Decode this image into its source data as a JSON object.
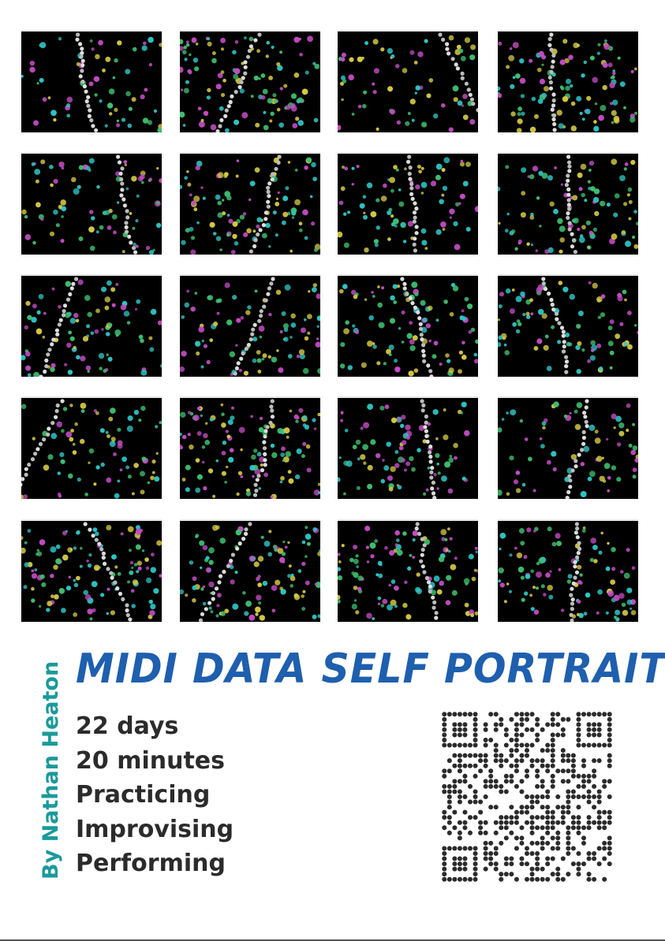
{
  "poster": {
    "title": "MIDI DATA SELF PORTRAIT",
    "author": "By Nathan Heaton",
    "stats": [
      "22 days",
      "20 minutes",
      "Practicing",
      "Improvising",
      "Performing"
    ]
  },
  "colors": {
    "title": "#1e5fae",
    "author": "#1a9a9a",
    "text": "#2b2b2b",
    "dot_palette": [
      "#2ec4c4",
      "#d4c843",
      "#c44cc4",
      "#3fbf6f",
      "#bcbcbc"
    ]
  },
  "thumbnails": [
    {
      "id": "day-01"
    },
    {
      "id": "day-02"
    },
    {
      "id": "day-03"
    },
    {
      "id": "day-04"
    },
    {
      "id": "day-05"
    },
    {
      "id": "day-06"
    },
    {
      "id": "day-07"
    },
    {
      "id": "day-08"
    },
    {
      "id": "day-09"
    },
    {
      "id": "day-10"
    },
    {
      "id": "day-11"
    },
    {
      "id": "day-12"
    },
    {
      "id": "day-13"
    },
    {
      "id": "day-14"
    },
    {
      "id": "day-15"
    },
    {
      "id": "day-16"
    },
    {
      "id": "day-17"
    },
    {
      "id": "day-18"
    },
    {
      "id": "day-19"
    },
    {
      "id": "day-20"
    }
  ]
}
